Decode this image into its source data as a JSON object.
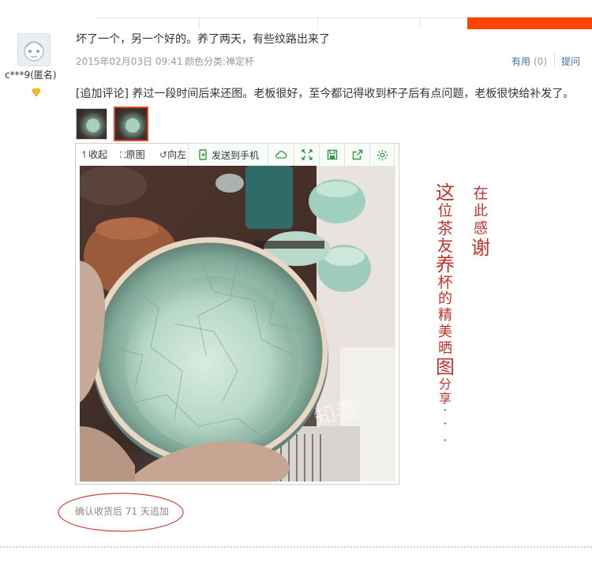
{
  "review": {
    "username": "c***9(匿名)",
    "text": "坏了一个，另一个好的。养了两天，有些纹路出来了",
    "date": "2015年02月03日 09:41",
    "color_category": "颜色分类:禅定杯",
    "useful_label": "有用",
    "useful_count": "(0)",
    "ask_label": "提问",
    "follow_up": "[追加评论] 养过一段时间后来还图。老板很好，至今都记得收到杯子后有点问题，老板很快给补发了。",
    "confirm_note": "确认收货后 71 天追加"
  },
  "viewer": {
    "collapse_label": "收起",
    "original_label": "原图",
    "rotate_label": "向左",
    "send_to_phone_label": "发送到手机"
  },
  "overlay": {
    "col1": [
      "这",
      "位",
      "茶",
      "友",
      "养",
      "杯",
      "的",
      "精",
      "美",
      "晒",
      "图",
      "分",
      "享",
      "·",
      "·",
      "·"
    ],
    "col2": [
      "在",
      "此",
      "感",
      "谢"
    ],
    "watermark": "知者"
  },
  "icons": [
    "avatar-icon",
    "vip-diamond-icon",
    "collapse-icon",
    "original-icon",
    "rotate-left-icon",
    "phone-icon",
    "cloud-icon",
    "fullscreen-icon",
    "save-icon",
    "share-icon",
    "settings-icon"
  ],
  "colors": {
    "accent_orange": "#ff4400",
    "link_blue": "#3a6fb6",
    "calligraphy_red": "#c0322b",
    "thumb_active_border": "#e4432c",
    "toolbar_green": "#2e9b3f"
  }
}
